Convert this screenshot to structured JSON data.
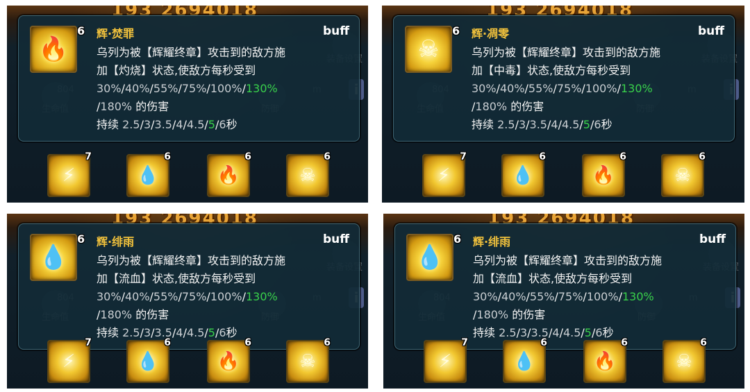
{
  "panels": [
    {
      "score": "193 2694018",
      "bg_labels": {
        "hp": "生命值",
        "defense": "防御",
        "equip": "装备设置",
        "hp_value": "804",
        "m": "m"
      },
      "tooltip": {
        "icon": "flame-icon",
        "level": "6",
        "title": "辉·焚罪",
        "tag": "buff",
        "line1": "乌列为被【辉耀终章】攻击到的敌方施",
        "line2": "加【灼烧】状态,使敌方每秒受到",
        "pct": [
          "30%",
          "40%",
          "55%",
          "75%",
          "100%",
          "130%"
        ],
        "pct_tail": "180%",
        "damage": "的伤害",
        "dur_label": "持续",
        "dur": [
          "2.5",
          "3",
          "3.5",
          "4",
          "4.5",
          "5",
          "6"
        ],
        "sec": "秒"
      },
      "slots": [
        {
          "icon": "lightning-slash-icon",
          "level": "7"
        },
        {
          "icon": "drop-icon",
          "level": "6"
        },
        {
          "icon": "flame-icon",
          "level": "6"
        },
        {
          "icon": "skull-icon",
          "level": "6"
        }
      ]
    },
    {
      "score": "193 2694018",
      "bg_labels": {
        "hp": "生命值",
        "defense": "防御",
        "equip": "装备设置",
        "hp_value": "804",
        "m": "m"
      },
      "tooltip": {
        "icon": "skull-icon",
        "level": "6",
        "title": "辉·凋零",
        "tag": "buff",
        "line1": "乌列为被【辉耀终章】攻击到的敌方施",
        "line2": "加【中毒】状态,使敌方每秒受到",
        "pct": [
          "30%",
          "40%",
          "55%",
          "75%",
          "100%",
          "130%"
        ],
        "pct_tail": "180%",
        "damage": "的伤害",
        "dur_label": "持续",
        "dur": [
          "2.5",
          "3",
          "3.5",
          "4",
          "4.5",
          "5",
          "6"
        ],
        "sec": "秒"
      },
      "slots": [
        {
          "icon": "lightning-slash-icon",
          "level": "7"
        },
        {
          "icon": "drop-icon",
          "level": "6"
        },
        {
          "icon": "flame-icon",
          "level": "6"
        },
        {
          "icon": "skull-icon",
          "level": "6"
        }
      ]
    },
    {
      "score": "193 2694018",
      "bg_labels": {
        "hp": "生命值",
        "defense": "防御",
        "equip": "装备设置",
        "hp_value": "804",
        "m": "m"
      },
      "tooltip": {
        "icon": "drop-icon",
        "level": "6",
        "title": "辉·绯雨",
        "tag": "buff",
        "line1": "乌列为被【辉耀终章】攻击到的敌方施",
        "line2": "加【流血】状态,使敌方每秒受到",
        "pct": [
          "30%",
          "40%",
          "55%",
          "75%",
          "100%",
          "130%"
        ],
        "pct_tail": "180%",
        "damage": "的伤害",
        "dur_label": "持续",
        "dur": [
          "2.5",
          "3",
          "3.5",
          "4",
          "4.5",
          "5",
          "6"
        ],
        "sec": "秒"
      },
      "slots": [
        {
          "icon": "lightning-slash-icon",
          "level": "7"
        },
        {
          "icon": "drop-icon",
          "level": "6"
        },
        {
          "icon": "flame-icon",
          "level": "6"
        },
        {
          "icon": "skull-icon",
          "level": "6"
        }
      ]
    },
    {
      "score": "193 2694018",
      "bg_labels": {
        "hp": "生命值",
        "defense": "防御",
        "equip": "装备设置",
        "hp_value": "804",
        "m": "m"
      },
      "tooltip": {
        "icon": "drop-icon",
        "level": "6",
        "title": "辉·绯雨",
        "tag": "buff",
        "line1": "乌列为被【辉耀终章】攻击到的敌方施",
        "line2": "加【流血】状态,使敌方每秒受到",
        "pct": [
          "30%",
          "40%",
          "55%",
          "75%",
          "100%",
          "130%"
        ],
        "pct_tail": "180%",
        "damage": "的伤害",
        "dur_label": "持续",
        "dur": [
          "2.5",
          "3",
          "3.5",
          "4",
          "4.5",
          "5",
          "6"
        ],
        "sec": "秒"
      },
      "slots": [
        {
          "icon": "lightning-slash-icon",
          "level": "7"
        },
        {
          "icon": "drop-icon",
          "level": "6"
        },
        {
          "icon": "flame-icon",
          "level": "6"
        },
        {
          "icon": "skull-icon",
          "level": "6"
        }
      ]
    }
  ],
  "colors": {
    "title": "#f2c23c",
    "highlight": "#39d24b",
    "tooltip_bg": "#122a36"
  }
}
